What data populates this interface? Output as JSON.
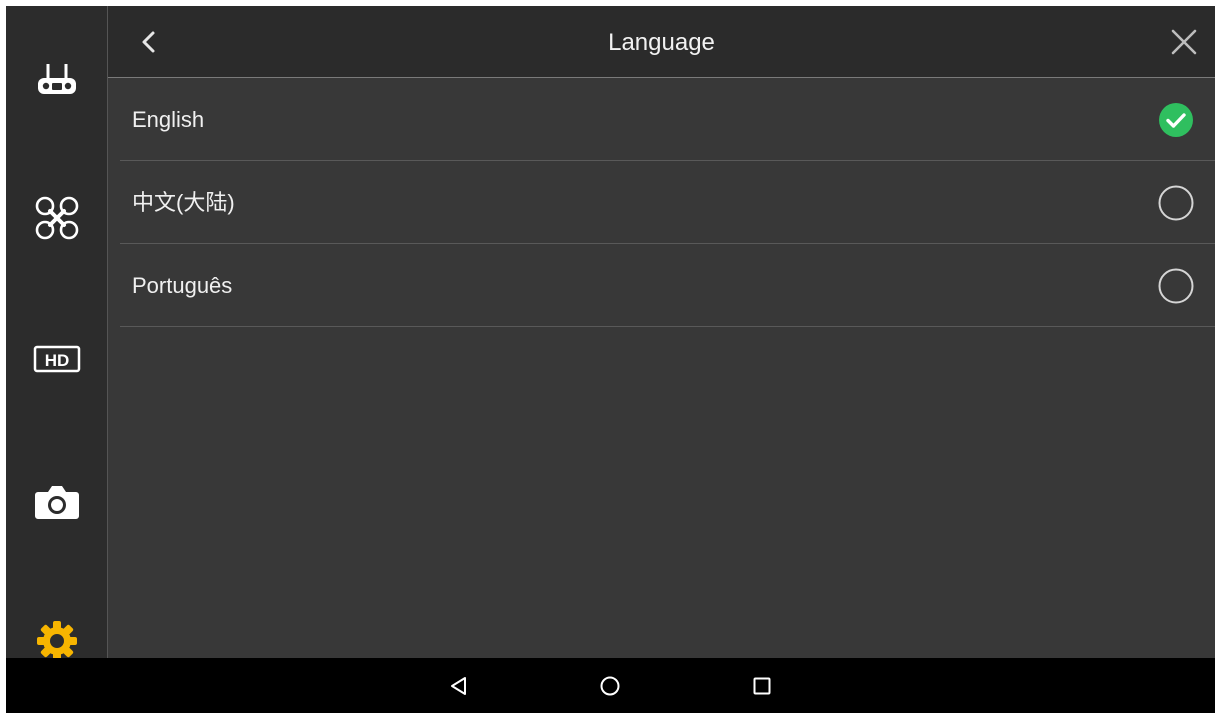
{
  "header": {
    "title": "Language",
    "back_icon": "chevron-left-icon",
    "close_icon": "close-icon"
  },
  "sidebar": {
    "items": [
      {
        "name": "remote-controller",
        "icon": "remote-controller-icon",
        "active": false
      },
      {
        "name": "aircraft",
        "icon": "drone-icon",
        "active": false
      },
      {
        "name": "hd-transmission",
        "icon": "hd-icon",
        "active": false
      },
      {
        "name": "camera",
        "icon": "camera-icon",
        "active": false
      },
      {
        "name": "settings",
        "icon": "gear-icon",
        "active": true
      }
    ]
  },
  "languages": [
    {
      "label": "English",
      "selected": true
    },
    {
      "label": "中文(大陆)",
      "selected": false
    },
    {
      "label": "Português",
      "selected": false
    }
  ],
  "navbar": {
    "buttons": [
      "back-triangle-icon",
      "home-circle-icon",
      "recents-square-icon"
    ]
  },
  "colors": {
    "accent_active": "#f7b500",
    "selected_check": "#2fbf5f",
    "background": "#383838",
    "header": "#2b2b2b",
    "sidebar": "#2c2c2c"
  }
}
